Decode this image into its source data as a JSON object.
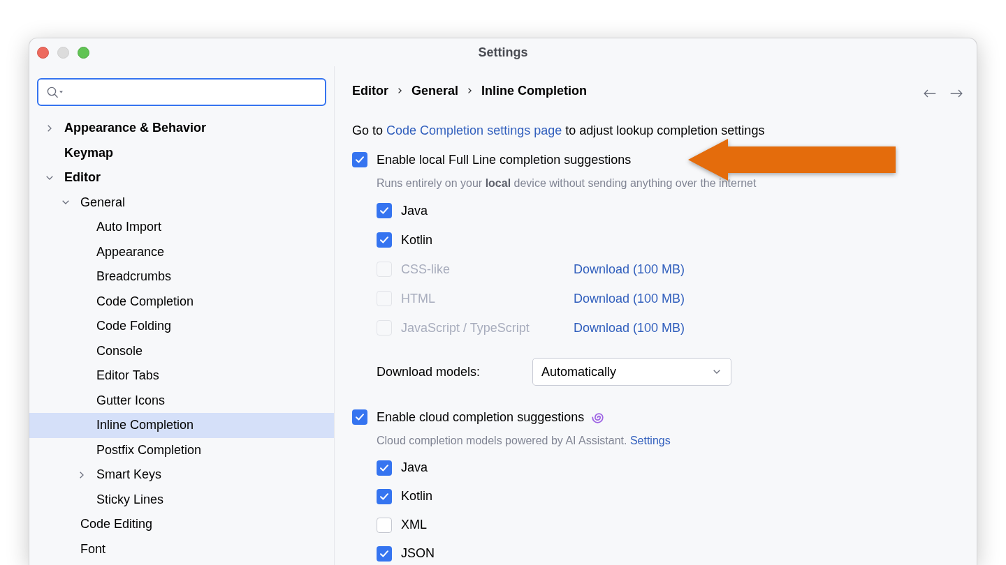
{
  "window": {
    "title": "Settings",
    "controls": [
      {
        "kind": "close",
        "disabled": false
      },
      {
        "kind": "minimize",
        "disabled": true
      },
      {
        "kind": "zoom",
        "disabled": false
      }
    ]
  },
  "sidebar": {
    "search": {
      "focused": true
    },
    "tree": [
      {
        "label": "Appearance & Behavior",
        "expanded": false,
        "selected": false
      },
      {
        "label": "Keymap",
        "selected": false
      },
      {
        "label": "Editor",
        "expanded": true,
        "selected": false,
        "children": [
          {
            "label": "General",
            "expanded": true,
            "selected": false,
            "children": [
              {
                "label": "Auto Import",
                "selected": false
              },
              {
                "label": "Appearance",
                "selected": false
              },
              {
                "label": "Breadcrumbs",
                "selected": false
              },
              {
                "label": "Code Completion",
                "selected": false
              },
              {
                "label": "Code Folding",
                "selected": false
              },
              {
                "label": "Console",
                "selected": false
              },
              {
                "label": "Editor Tabs",
                "selected": false
              },
              {
                "label": "Gutter Icons",
                "selected": false
              },
              {
                "label": "Inline Completion",
                "selected": true
              },
              {
                "label": "Postfix Completion",
                "selected": false
              },
              {
                "label": "Smart Keys",
                "expanded": false,
                "selected": false
              },
              {
                "label": "Sticky Lines",
                "selected": false
              }
            ]
          },
          {
            "label": "Code Editing",
            "selected": false
          },
          {
            "label": "Font",
            "selected": false
          }
        ]
      }
    ]
  },
  "content": {
    "breadcrumbs": [
      "Editor",
      "General",
      "Inline Completion"
    ],
    "intro": {
      "before": "Go to",
      "link": "Code Completion settings page",
      "after": "to adjust lookup completion settings"
    },
    "local": {
      "label": "Enable local Full Line completion suggestions",
      "checked": true,
      "description": "Runs entirely on your **local** device without sending anything over the internet",
      "languages": [
        {
          "label": "Java",
          "checked": true,
          "disabled": false
        },
        {
          "label": "Kotlin",
          "checked": true,
          "disabled": false
        },
        {
          "label": "CSS-like",
          "checked": false,
          "disabled": true,
          "download": "Download (100 MB)"
        },
        {
          "label": "HTML",
          "checked": false,
          "disabled": true,
          "download": "Download (100 MB)"
        },
        {
          "label": "JavaScript / TypeScript",
          "checked": false,
          "disabled": true,
          "download": "Download (100 MB)"
        }
      ],
      "download_models": {
        "label": "Download models:",
        "value": "Automatically"
      }
    },
    "cloud": {
      "label": "Enable cloud completion suggestions",
      "checked": true,
      "description": "Cloud completion models powered by AI Assistant.",
      "link": "Settings",
      "languages": [
        {
          "label": "Java",
          "checked": true,
          "disabled": false
        },
        {
          "label": "Kotlin",
          "checked": true,
          "disabled": false
        },
        {
          "label": "XML",
          "checked": false,
          "disabled": false
        },
        {
          "label": "JSON",
          "checked": true,
          "disabled": false
        }
      ]
    }
  }
}
